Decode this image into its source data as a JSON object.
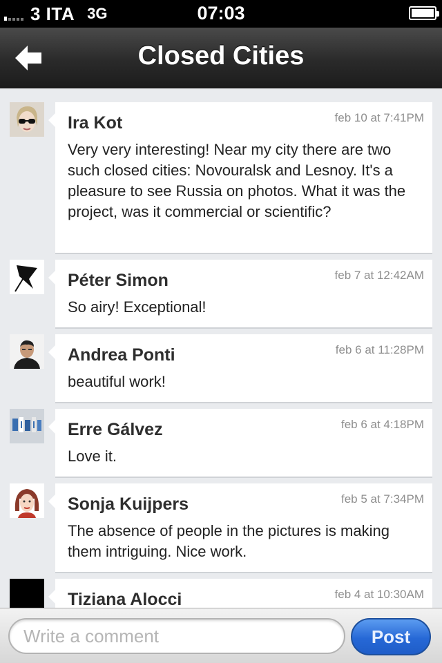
{
  "status_bar": {
    "carrier": "3 ITA",
    "network": "3G",
    "time": "07:03",
    "signal_bars": 1,
    "battery_level": 0.95
  },
  "nav": {
    "title": "Closed Cities",
    "back_icon": "back-arrow-icon"
  },
  "comments": [
    {
      "name": "Ira Kot",
      "time": "feb 10 at 7:41PM",
      "text": "Very very interesting! Near my city there are two such closed cities: Novouralsk and Lesnoy. It's a pleasure to see Russia on photos. What it was the project, was it commercial or scientific?"
    },
    {
      "name": "Péter Simon",
      "time": "feb 7 at 12:42AM",
      "text": "So airy! Exceptional!"
    },
    {
      "name": "Andrea Ponti",
      "time": "feb 6 at 11:28PM",
      "text": "beautiful work!"
    },
    {
      "name": "Erre Gálvez",
      "time": "feb 6 at 4:18PM",
      "text": "Love it."
    },
    {
      "name": "Sonja Kuijpers",
      "time": "feb 5 at 7:34PM",
      "text": "The absence of people in the pictures is making them intriguing. Nice work."
    },
    {
      "name": "Tiziana Alocci",
      "time": "feb 4 at 10:30AM",
      "text": ""
    }
  ],
  "input": {
    "placeholder": "Write a comment",
    "value": ""
  },
  "post_button": {
    "label": "Post"
  },
  "colors": {
    "accent": "#2668d6",
    "background": "#e9ebee"
  }
}
